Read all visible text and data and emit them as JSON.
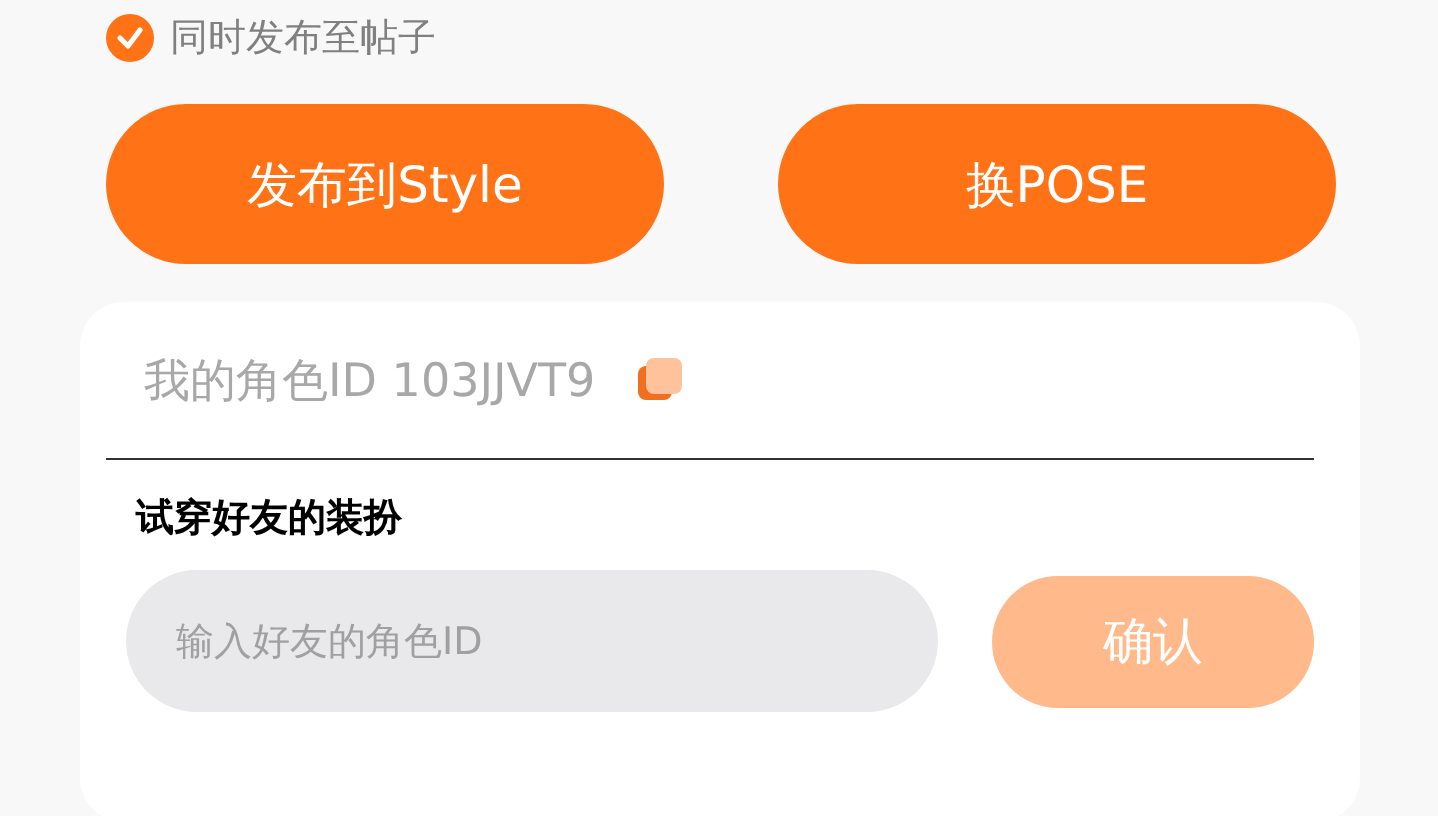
{
  "sync_option": {
    "label": "同时发布至帖子",
    "checked": true
  },
  "buttons": [
    {
      "label": "发布到Style"
    },
    {
      "label": "换POSE"
    }
  ],
  "my_id": {
    "text": "我的角色ID 103JJVT9"
  },
  "try_on": {
    "heading": "试穿好友的装扮",
    "input": {
      "placeholder": "输入好友的角色ID"
    },
    "confirm": {
      "label": "确认",
      "disabled": true
    }
  }
}
